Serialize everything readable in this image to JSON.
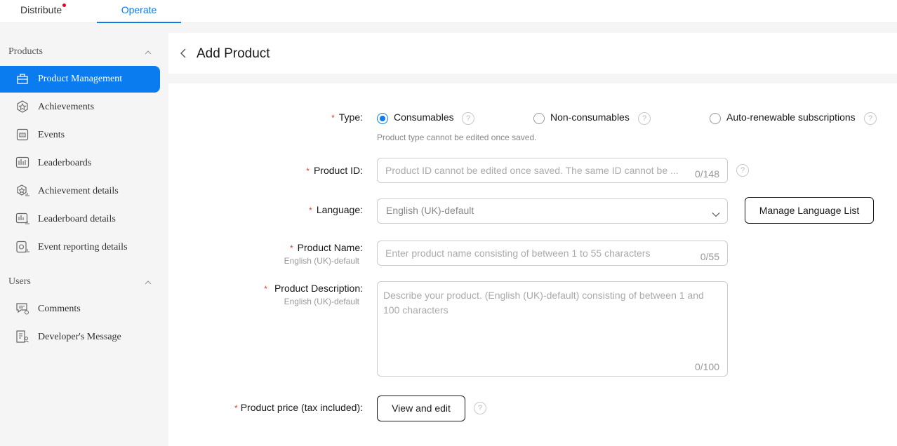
{
  "tabs": {
    "distribute": "Distribute",
    "operate": "Operate"
  },
  "sidebar": {
    "products_title": "Products",
    "users_title": "Users",
    "items": [
      {
        "label": "Product Management",
        "icon": "bag-icon"
      },
      {
        "label": "Achievements",
        "icon": "badge-icon"
      },
      {
        "label": "Events",
        "icon": "event-icon"
      },
      {
        "label": "Leaderboards",
        "icon": "leaderboard-icon"
      },
      {
        "label": "Achievement details",
        "icon": "achievement-details-icon"
      },
      {
        "label": "Leaderboard details",
        "icon": "leaderboard-details-icon"
      },
      {
        "label": "Event reporting details",
        "icon": "event-report-icon"
      }
    ],
    "user_items": [
      {
        "label": "Comments",
        "icon": "comments-icon"
      },
      {
        "label": "Developer's Message",
        "icon": "developer-message-icon"
      }
    ]
  },
  "header": {
    "title": "Add Product"
  },
  "form": {
    "type": {
      "label": "Type:",
      "options": [
        "Consumables",
        "Non-consumables",
        "Auto-renewable subscriptions"
      ],
      "selected": "Consumables",
      "hint": "Product type cannot be edited once saved."
    },
    "product_id": {
      "label": "Product ID:",
      "placeholder": "Product ID cannot be edited once saved. The same ID cannot be ...",
      "count": "0/148"
    },
    "language": {
      "label": "Language:",
      "value": "English (UK)-default",
      "manage_button": "Manage Language List"
    },
    "product_name": {
      "label": "Product Name:",
      "sublabel": "English (UK)-default",
      "placeholder": "Enter product name consisting of between 1 to 55 characters",
      "count": "0/55"
    },
    "product_description": {
      "label": "Product Description:",
      "sublabel": "English (UK)-default",
      "placeholder": "Describe your product. (English (UK)-default) consisting of between 1 and 100 characters",
      "count": "0/100"
    },
    "price": {
      "label": "Product price (tax included):",
      "button": "View and edit"
    },
    "required_mark": "*",
    "help_glyph": "?"
  },
  "colors": {
    "accent": "#0a7cf0",
    "required": "#e84026"
  }
}
